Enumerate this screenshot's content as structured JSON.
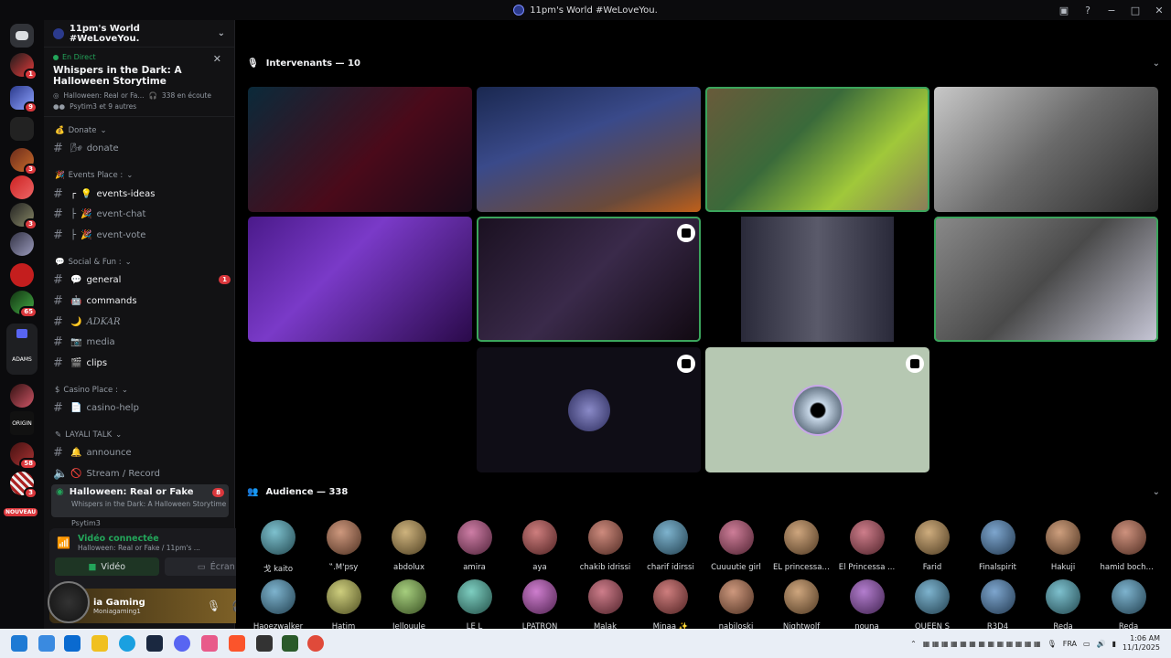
{
  "window": {
    "title": "11pm's World #WeLoveYou.",
    "controls": [
      "−",
      "□",
      "✕"
    ]
  },
  "server": {
    "name": "11pm's World #WeLoveYou."
  },
  "stage_card": {
    "live_label": "En Direct",
    "title": "Whispers in the Dark: A Halloween Storytime",
    "channel": "Halloween: Real or Fa...",
    "listeners": "338 en écoute",
    "speakers": "Psytim3 et 9 autres"
  },
  "guild_badges": [
    "1",
    "9",
    "3",
    "3",
    "3",
    "65",
    "58",
    "3"
  ],
  "guild_labels": {
    "adams": "ADAMS",
    "origin": "ORIGIN",
    "new": "NOUVEAU"
  },
  "categories": {
    "donate": "Donate",
    "events": "Events Place :",
    "social": "Social & Fun :",
    "casino": "Casino Place :",
    "layali": "LAYALI TALK"
  },
  "channels": [
    {
      "name": "donate",
      "icon": "🌬"
    },
    {
      "name": "events-ideas",
      "icon": "💡"
    },
    {
      "name": "event-chat",
      "icon": "🎉"
    },
    {
      "name": "event-vote",
      "icon": "🎉"
    },
    {
      "name": "general",
      "icon": "💬",
      "badge": "1"
    },
    {
      "name": "commands",
      "icon": "🤖"
    },
    {
      "name": "ADKAR",
      "icon": "🌙"
    },
    {
      "name": "media",
      "icon": "📷"
    },
    {
      "name": "clips",
      "icon": "🎬"
    },
    {
      "name": "casino-help",
      "icon": "📄"
    },
    {
      "name": "announce",
      "icon": "🔔"
    },
    {
      "name": "Stream / Record",
      "icon": "🚫"
    }
  ],
  "active_channel": {
    "name": "Halloween: Real or Fake",
    "badge": "8",
    "subtitle": "Whispers in the Dark: A Halloween Storytime"
  },
  "voice_user": "Psytim3",
  "voice_panel": {
    "status": "Vidéo connectée",
    "channel": "Halloween: Real or Fake / 11pm's ...",
    "video_btn": "Vidéo",
    "screen_btn": "Écran"
  },
  "user_panel": {
    "name": "ia Gaming",
    "status": "Moniagaming1"
  },
  "speakers_header": "Intervenants — 10",
  "audience_header": "Audience — 338",
  "audience": [
    "戈 kaito",
    "‟.M'psy",
    "abdolux",
    "amira",
    "aya",
    "chakib idrissi",
    "charif idirssi",
    "Cuuuutie girl",
    "EL princessa \"...",
    "El Princessa ...",
    "Farid",
    "Finalspirit",
    "Hakuji",
    "hamid bochna9",
    "Haoezwalker",
    "Hatim",
    "Jellouule",
    "LE L",
    "LPATRON",
    "Malak",
    "Minaa ✨",
    "nabiloski",
    "Nightwolf",
    "nouna",
    "QUEEN S",
    "R3D4",
    "Reda",
    "Reda"
  ],
  "tray": {
    "lang": "FRA",
    "time": "1:06 AM",
    "date": "11/1/2025"
  },
  "colors": {
    "speaking": "#3ba55c",
    "badge": "#da373c",
    "accent": "#5865f2",
    "live": "#23a55a"
  }
}
